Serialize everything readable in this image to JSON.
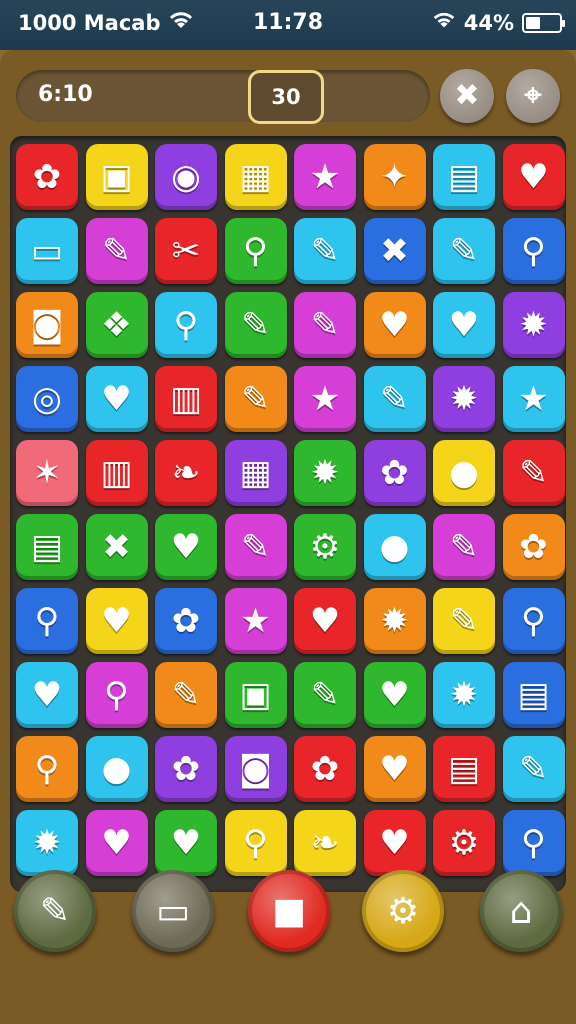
{
  "status_bar": {
    "left_text": "1000 Macab",
    "time": "11:78",
    "battery_percent": "44%",
    "battery_level": 0.44
  },
  "hud": {
    "timer": "6:10",
    "score": "30"
  },
  "colors": {
    "red": "#e8262a",
    "yellow": "#f5d51a",
    "purple": "#8f3fe0",
    "cyan": "#2ec4ee",
    "green": "#2fb82e",
    "orange": "#f28a1a",
    "blue": "#2a6ee0",
    "magenta": "#d63fd6",
    "pink": "#f06a7a"
  },
  "board": [
    [
      {
        "c": "red",
        "g": "✿"
      },
      {
        "c": "yellow",
        "g": "▣"
      },
      {
        "c": "purple",
        "g": "◉"
      },
      {
        "c": "yellow",
        "g": "▦"
      },
      {
        "c": "magenta",
        "g": "★"
      },
      {
        "c": "orange",
        "g": "✦"
      },
      {
        "c": "cyan",
        "g": "▤"
      },
      {
        "c": "red",
        "g": "♥"
      }
    ],
    [
      {
        "c": "cyan",
        "g": "▭"
      },
      {
        "c": "magenta",
        "g": "✎"
      },
      {
        "c": "red",
        "g": "✂"
      },
      {
        "c": "green",
        "g": "⚲"
      },
      {
        "c": "cyan",
        "g": "✎"
      },
      {
        "c": "blue",
        "g": "✖"
      },
      {
        "c": "cyan",
        "g": "✎"
      },
      {
        "c": "blue",
        "g": "⚲"
      }
    ],
    [
      {
        "c": "orange",
        "g": "◙"
      },
      {
        "c": "green",
        "g": "❖"
      },
      {
        "c": "cyan",
        "g": "⚲"
      },
      {
        "c": "green",
        "g": "✎"
      },
      {
        "c": "magenta",
        "g": "✎"
      },
      {
        "c": "orange",
        "g": "♥"
      },
      {
        "c": "cyan",
        "g": "♥"
      },
      {
        "c": "purple",
        "g": "✹"
      }
    ],
    [
      {
        "c": "blue",
        "g": "◎"
      },
      {
        "c": "cyan",
        "g": "♥"
      },
      {
        "c": "red",
        "g": "▥"
      },
      {
        "c": "orange",
        "g": "✎"
      },
      {
        "c": "magenta",
        "g": "★"
      },
      {
        "c": "cyan",
        "g": "✎"
      },
      {
        "c": "purple",
        "g": "✹"
      },
      {
        "c": "cyan",
        "g": "★"
      }
    ],
    [
      {
        "c": "pink",
        "g": "✶"
      },
      {
        "c": "red",
        "g": "▥"
      },
      {
        "c": "red",
        "g": "❧"
      },
      {
        "c": "purple",
        "g": "▦"
      },
      {
        "c": "green",
        "g": "✹"
      },
      {
        "c": "purple",
        "g": "✿"
      },
      {
        "c": "yellow",
        "g": "●"
      },
      {
        "c": "red",
        "g": "✎"
      }
    ],
    [
      {
        "c": "green",
        "g": "▤"
      },
      {
        "c": "green",
        "g": "✖"
      },
      {
        "c": "green",
        "g": "♥"
      },
      {
        "c": "magenta",
        "g": "✎"
      },
      {
        "c": "green",
        "g": "⚙"
      },
      {
        "c": "cyan",
        "g": "●"
      },
      {
        "c": "magenta",
        "g": "✎"
      },
      {
        "c": "orange",
        "g": "✿"
      }
    ],
    [
      {
        "c": "blue",
        "g": "⚲"
      },
      {
        "c": "yellow",
        "g": "♥"
      },
      {
        "c": "blue",
        "g": "✿"
      },
      {
        "c": "magenta",
        "g": "★"
      },
      {
        "c": "red",
        "g": "♥"
      },
      {
        "c": "orange",
        "g": "✹"
      },
      {
        "c": "yellow",
        "g": "✎"
      },
      {
        "c": "blue",
        "g": "⚲"
      }
    ],
    [
      {
        "c": "cyan",
        "g": "♥"
      },
      {
        "c": "magenta",
        "g": "⚲"
      },
      {
        "c": "orange",
        "g": "✎"
      },
      {
        "c": "green",
        "g": "▣"
      },
      {
        "c": "green",
        "g": "✎"
      },
      {
        "c": "green",
        "g": "♥"
      },
      {
        "c": "cyan",
        "g": "✹"
      },
      {
        "c": "blue",
        "g": "▤"
      }
    ],
    [
      {
        "c": "orange",
        "g": "⚲"
      },
      {
        "c": "cyan",
        "g": "●"
      },
      {
        "c": "purple",
        "g": "✿"
      },
      {
        "c": "purple",
        "g": "◙"
      },
      {
        "c": "red",
        "g": "✿"
      },
      {
        "c": "orange",
        "g": "♥"
      },
      {
        "c": "red",
        "g": "▤"
      },
      {
        "c": "cyan",
        "g": "✎"
      }
    ],
    [
      {
        "c": "cyan",
        "g": "✹"
      },
      {
        "c": "magenta",
        "g": "♥"
      },
      {
        "c": "green",
        "g": "♥"
      },
      {
        "c": "yellow",
        "g": "⚲"
      },
      {
        "c": "yellow",
        "g": "❧"
      },
      {
        "c": "red",
        "g": "♥"
      },
      {
        "c": "red",
        "g": "⚙"
      },
      {
        "c": "blue",
        "g": "⚲"
      }
    ]
  ],
  "bottom_buttons": [
    {
      "name": "brush-button",
      "bg": "#5e6a40",
      "glyph": "✎"
    },
    {
      "name": "chat-button",
      "bg": "#6e6a55",
      "glyph": "▭"
    },
    {
      "name": "record-button",
      "bg": "#e02a22",
      "glyph": "■"
    },
    {
      "name": "settings-button",
      "bg": "#d6a817",
      "glyph": "⚙"
    },
    {
      "name": "home-button",
      "bg": "#5e6a40",
      "glyph": "⌂"
    }
  ]
}
